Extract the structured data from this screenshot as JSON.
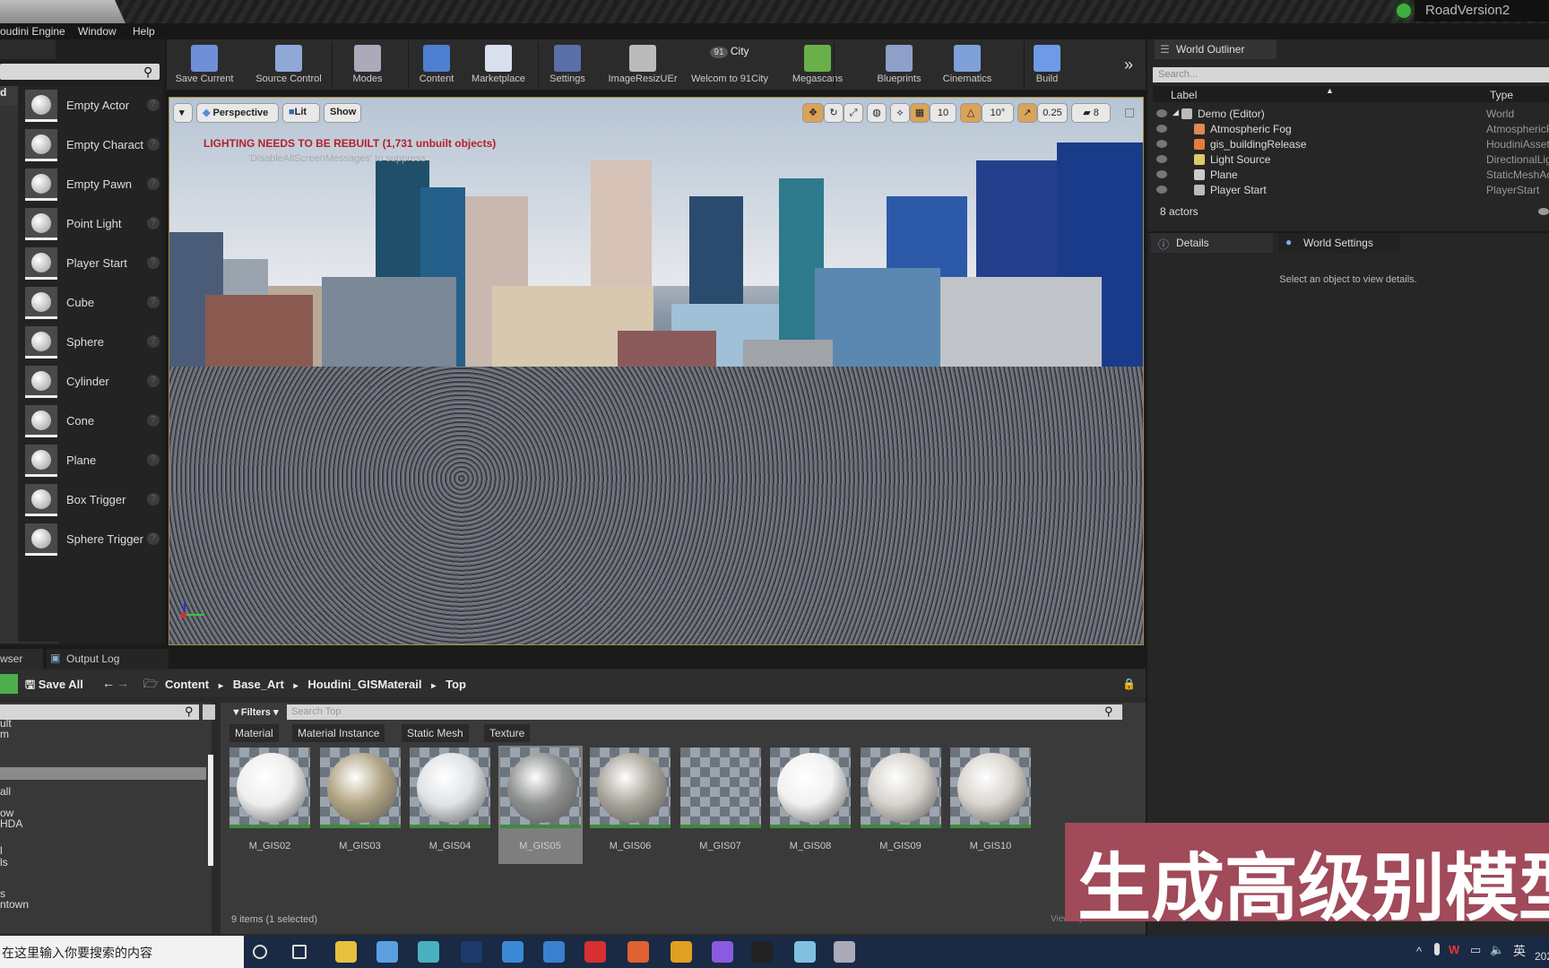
{
  "window": {
    "project_name": "RoadVersion2"
  },
  "menu": [
    "oudini Engine",
    "Window",
    "Help"
  ],
  "place_panel": {
    "category_partial": "d",
    "items": [
      {
        "label": "Empty Actor"
      },
      {
        "label": "Empty Charact"
      },
      {
        "label": "Empty Pawn"
      },
      {
        "label": "Point Light"
      },
      {
        "label": "Player Start"
      },
      {
        "label": "Cube"
      },
      {
        "label": "Sphere"
      },
      {
        "label": "Cylinder"
      },
      {
        "label": "Cone"
      },
      {
        "label": "Plane"
      },
      {
        "label": "Box Trigger"
      },
      {
        "label": "Sphere Trigger"
      }
    ],
    "help_glyph": "?"
  },
  "toolbar": [
    {
      "label": "Save Current",
      "icon": "save-icon",
      "color": "#6f8fd8"
    },
    {
      "label": "Source Control",
      "icon": "source-control-icon",
      "color": "#8fa8d8"
    },
    {
      "label": "Modes",
      "icon": "modes-icon",
      "color": "#aab"
    },
    {
      "label": "Content",
      "icon": "content-icon",
      "color": "#4f7fd0"
    },
    {
      "label": "Marketplace",
      "icon": "marketplace-icon",
      "color": "#d8e0ee"
    },
    {
      "label": "Settings",
      "icon": "settings-icon",
      "color": "#5b6fa8"
    },
    {
      "label": "ImageResizUEr",
      "icon": "checker-icon",
      "color": "#bbb"
    },
    {
      "label": "Welcom to 91City",
      "icon": "91city-icon",
      "color": "#555",
      "badge": "91",
      "badge_text": "City"
    },
    {
      "label": "Megascans",
      "icon": "megascans-icon",
      "color": "#6ab04a"
    },
    {
      "label": "Blueprints",
      "icon": "blueprints-icon",
      "color": "#8fa0c8"
    },
    {
      "label": "Cinematics",
      "icon": "cinematics-icon",
      "color": "#7fa0d8"
    },
    {
      "label": "Build",
      "icon": "build-icon",
      "color": "#6f9ae8"
    }
  ],
  "toolbar_more": "»",
  "viewport": {
    "view_mode": "Perspective",
    "lighting": "Lit",
    "show": "Show",
    "warning": "LIGHTING NEEDS TO BE REBUILT (1,731 unbuilt objects)",
    "warning_sub": "'DisableAllScreenMessages' to suppress",
    "grid_snap": "10",
    "rotation_snap": "10°",
    "scale_snap": "0.25",
    "camera_speed": "8"
  },
  "outliner": {
    "tab": "World Outliner",
    "search_placeholder": "Search...",
    "col_label": "Label",
    "col_type": "Type",
    "rows": [
      {
        "label": "Demo (Editor)",
        "type": "World"
      },
      {
        "label": "Atmospheric Fog",
        "type": "AtmosphericF"
      },
      {
        "label": "gis_buildingRelease",
        "type": "HoudiniAsset"
      },
      {
        "label": "Light Source",
        "type": "DirectionalLig"
      },
      {
        "label": "Plane",
        "type": "StaticMeshAc"
      },
      {
        "label": "Player Start",
        "type": "PlayerStart"
      }
    ],
    "count": "8 actors"
  },
  "details": {
    "tabs": [
      "Details",
      "World Settings"
    ],
    "message": "Select an object to view details."
  },
  "content_browser": {
    "tabs": [
      "wser",
      "Output Log"
    ],
    "save_all": "Save All",
    "path": [
      "Content",
      "Base_Art",
      "Houdini_GISMaterail",
      "Top"
    ],
    "filters": "Filters",
    "search_placeholder": "Search Top",
    "chips": [
      "Material",
      "Material Instance",
      "Static Mesh",
      "Texture"
    ],
    "tree_items": [
      "ult",
      "m",
      "all",
      "ow",
      "HDA",
      "l",
      "ls",
      "s",
      "ntown"
    ],
    "assets": [
      {
        "name": "M_GIS02",
        "color": "#eeeeee"
      },
      {
        "name": "M_GIS03",
        "color": "#b0a482"
      },
      {
        "name": "M_GIS04",
        "color": "#dfe3e6"
      },
      {
        "name": "M_GIS05",
        "color": "#8e9090",
        "selected": true
      },
      {
        "name": "M_GIS06",
        "color": "#a9a49a"
      },
      {
        "name": "M_GIS07",
        "color": ""
      },
      {
        "name": "M_GIS08",
        "color": "#f1f1f1"
      },
      {
        "name": "M_GIS09",
        "color": "#d6d2cc"
      },
      {
        "name": "M_GIS10",
        "color": "#d8d4ce"
      }
    ],
    "count": "9 items (1 selected)",
    "view_options": "View Options"
  },
  "banner": "生成高级别模型",
  "taskbar": {
    "search_placeholder": "在这里输入你要搜索的内容",
    "ime": "英",
    "clock_partial": "202"
  }
}
